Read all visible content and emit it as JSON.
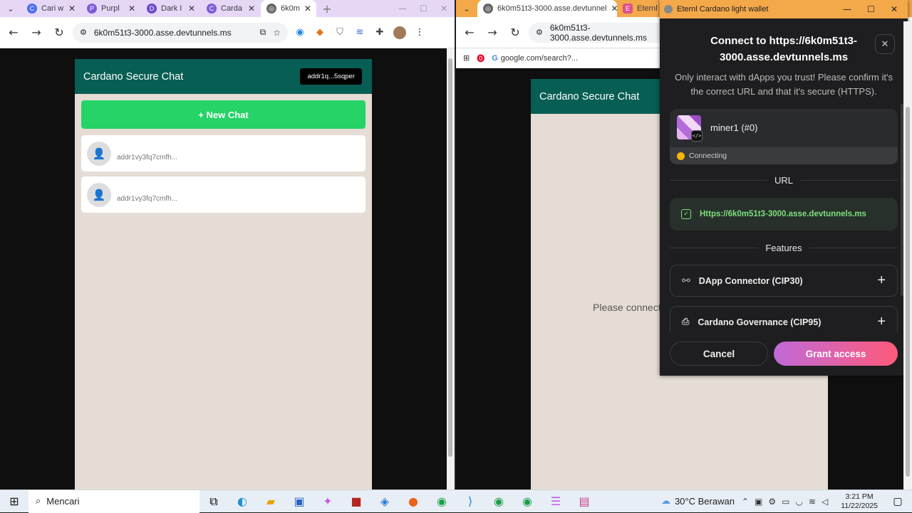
{
  "left_browser": {
    "tabs": [
      {
        "label": "Cari w",
        "color": "#4c6ef5"
      },
      {
        "label": "Purpl",
        "color": "#7b5cd6"
      },
      {
        "label": "Dark I",
        "color": "#6f49c9"
      },
      {
        "label": "Carda",
        "color": "#7b5cd6"
      },
      {
        "label": "6k0m",
        "color": "#666666"
      }
    ],
    "new_tab": "+",
    "url": "6k0m51t3-3000.asse.devtunnels.ms"
  },
  "left_app": {
    "title": "Cardano Secure Chat",
    "address_pill": "addr1q...5sqper",
    "new_chat": "+ New Chat",
    "chats": [
      {
        "address": "addr1vy3fq7cmfh..."
      },
      {
        "address": "addr1vy3fq7cmfh..."
      }
    ]
  },
  "right_browser": {
    "tabs": [
      {
        "label": "6k0m51t3-3000.asse.devtunnel",
        "color": "#666666"
      },
      {
        "label": "Eternl",
        "color": "#e0508a"
      }
    ],
    "url": "6k0m51t3-3000.asse.devtunnels.ms",
    "bookmark": "google.com/search?..."
  },
  "right_app": {
    "title": "Cardano Secure Chat",
    "message": "Please connect"
  },
  "wallet": {
    "window_title": "Eternl Cardano light wallet",
    "heading": "Connect to https://6k0m51t3-3000.asse.devtunnels.ms",
    "warning": "Only interact with dApps you trust! Please confirm it's the correct URL and that it's secure (HTTPS).",
    "account_name": "miner1 (#0)",
    "status": "Connecting",
    "url_label": "URL",
    "url": "Https://6k0m51t3-3000.asse.devtunnels.ms",
    "features_label": "Features",
    "features": [
      {
        "label": "DApp Connector (CIP30)",
        "icon": "link-icon"
      },
      {
        "label": "Cardano Governance (CIP95)",
        "icon": "governance-icon"
      }
    ],
    "cancel": "Cancel",
    "grant": "Grant access",
    "accent": "#d666c9",
    "url_color": "#7ee07e",
    "status_color": "#f2b705"
  },
  "taskbar": {
    "search": "Mencari",
    "weather": "30°C  Berawan",
    "time": "3:21 PM",
    "date": "11/22/2025"
  }
}
